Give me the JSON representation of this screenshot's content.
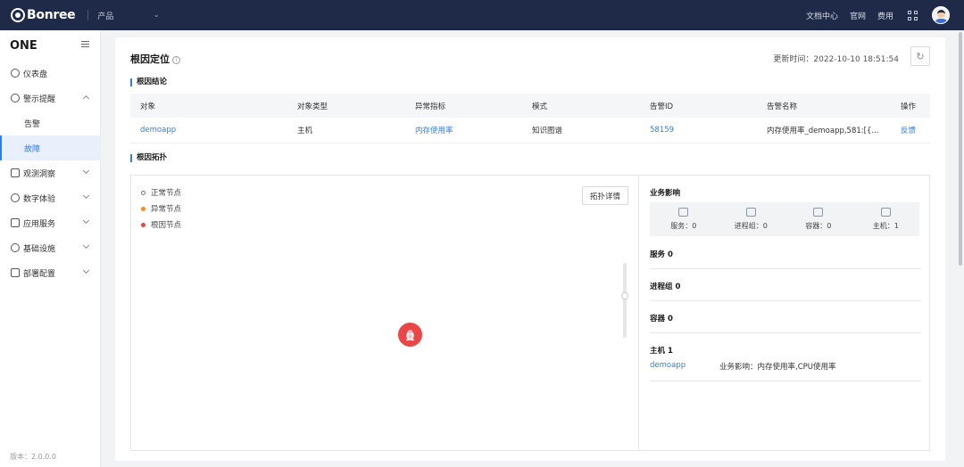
{
  "topbar": {
    "logo": "Bonree",
    "product": "产品",
    "links": [
      "文档中心",
      "官网",
      "费用"
    ]
  },
  "sidebar": {
    "brand": "ONE",
    "items": [
      {
        "label": "仪表盘"
      },
      {
        "label": "警示提醒"
      },
      {
        "label": "告警"
      },
      {
        "label": "故障"
      },
      {
        "label": "观测洞察"
      },
      {
        "label": "数字体验"
      },
      {
        "label": "应用服务"
      },
      {
        "label": "基础设施"
      },
      {
        "label": "部署配置"
      }
    ],
    "version": "版本：2.0.0.0"
  },
  "page": {
    "title": "根因定位",
    "update_label": "更新时间：2022-10-10 18:51:54",
    "section_conclusion": "根因结论",
    "section_topology": "根因拓扑"
  },
  "table": {
    "headers": [
      "对象",
      "对象类型",
      "异常指标",
      "模式",
      "告警ID",
      "告警名称",
      "操作"
    ],
    "row": {
      "object": "demoapp",
      "type": "主机",
      "metric": "内存使用率",
      "mode": "知识图谱",
      "alert_id": "58159",
      "alert_name": "内存使用率_demoapp,581:[{...",
      "action": "反馈"
    }
  },
  "topology": {
    "legend": [
      "正常节点",
      "异常节点",
      "根因节点"
    ],
    "detail_button": "拓扑详情"
  },
  "impact": {
    "title": "业务影响",
    "stats": [
      {
        "label": "服务：0",
        "icon": "service-icon"
      },
      {
        "label": "进程组：0",
        "icon": "process-group-icon"
      },
      {
        "label": "容器：0",
        "icon": "container-icon"
      },
      {
        "label": "主机：1",
        "icon": "host-icon"
      }
    ],
    "service": "服务 0",
    "process_group": "进程组 0",
    "container": "容器 0",
    "host": "主机 1",
    "host_name": "demoapp",
    "host_impact": "业务影响：内存使用率,CPU使用率"
  },
  "colors": {
    "accent": "#2f7cf0",
    "topbar": "#1f2a48",
    "root_node": "#ec4545",
    "abnormal_node": "#f5881f"
  }
}
